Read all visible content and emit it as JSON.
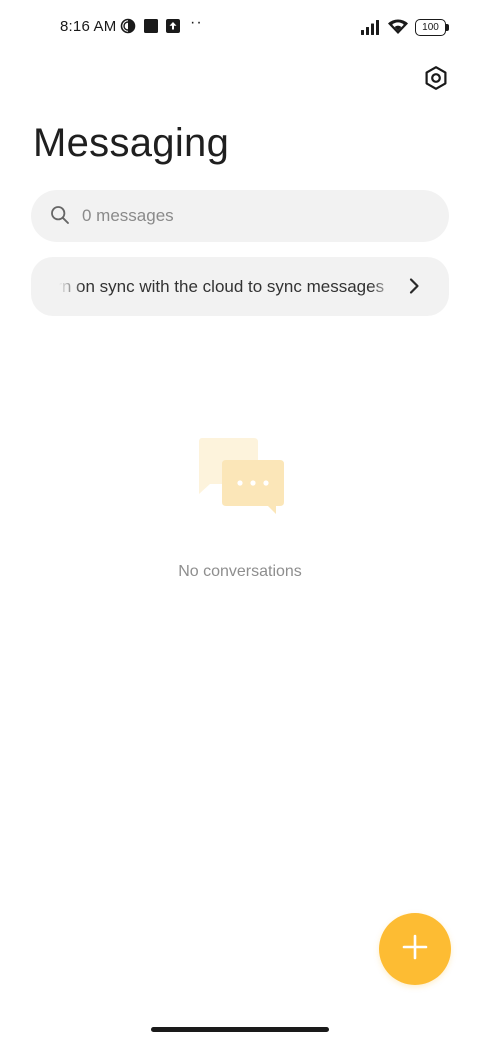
{
  "status_bar": {
    "time": "8:16 AM",
    "notification_icons": [
      "data-saver-icon",
      "square-app-icon",
      "upload-icon"
    ],
    "overflow_dots": "··",
    "battery_level": "100"
  },
  "header": {
    "title": "Messaging",
    "settings_icon": "settings-hexagon-icon"
  },
  "search": {
    "placeholder": "0 messages"
  },
  "sync_banner": {
    "text": "Turn on sync with the cloud to sync messages"
  },
  "empty_state": {
    "message": "No conversations"
  },
  "colors": {
    "accent": "#fdbc33",
    "illustration_light": "#fdf3dc",
    "illustration_dark": "#fbe6b8",
    "surface": "#f2f2f2"
  }
}
